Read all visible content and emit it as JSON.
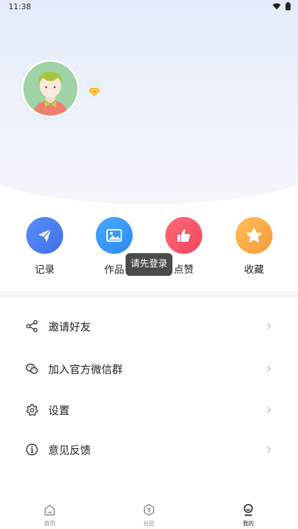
{
  "status_bar": {
    "time": "11:38"
  },
  "actions": [
    {
      "label": "记录",
      "icon": "paper-plane-icon",
      "color": "#4a7ff0"
    },
    {
      "label": "作品",
      "icon": "image-icon",
      "color": "#3a9af6"
    },
    {
      "label": "点赞",
      "icon": "thumbs-up-icon",
      "color": "#f4566a"
    },
    {
      "label": "收藏",
      "icon": "star-icon",
      "color": "#f8ac48"
    }
  ],
  "toast": "请先登录",
  "menu": [
    {
      "label": "邀请好友",
      "icon": "share-icon"
    },
    {
      "label": "加入官方微信群",
      "icon": "wechat-icon"
    },
    {
      "label": "设置",
      "icon": "gear-icon"
    },
    {
      "label": "意见反馈",
      "icon": "info-icon"
    }
  ],
  "bottom_nav": [
    {
      "label": "首页",
      "icon": "home-icon"
    },
    {
      "label": "社区",
      "icon": "community-icon"
    },
    {
      "label": "我的",
      "icon": "profile-icon",
      "active": true
    }
  ]
}
